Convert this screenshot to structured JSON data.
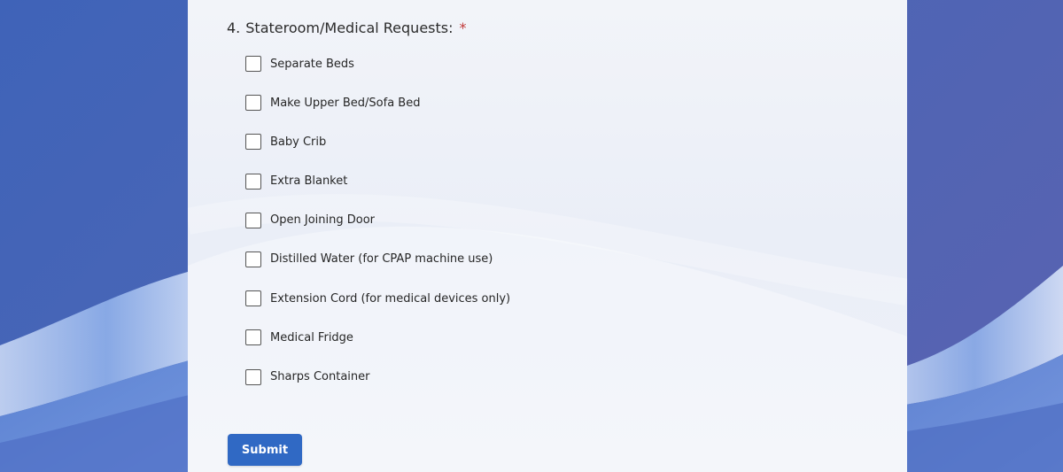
{
  "question": {
    "number": "4.",
    "title": "Stateroom/Medical Requests:",
    "required_mark": "*"
  },
  "options": [
    {
      "label": "Separate Beds",
      "checked": false
    },
    {
      "label": "Make Upper Bed/Sofa Bed",
      "checked": false
    },
    {
      "label": "Baby Crib",
      "checked": false
    },
    {
      "label": "Extra Blanket",
      "checked": false
    },
    {
      "label": "Open Joining Door",
      "checked": false
    },
    {
      "label": "Distilled Water (for CPAP machine use)",
      "checked": false
    },
    {
      "label": "Extension Cord (for medical devices only)",
      "checked": false
    },
    {
      "label": "Medical Fridge",
      "checked": false
    },
    {
      "label": "Sharps Container",
      "checked": false
    }
  ],
  "submit_label": "Submit",
  "colors": {
    "accent": "#3069c4",
    "required": "#c23a3a",
    "background": "#4a66b6",
    "card": "#eef1f8"
  }
}
